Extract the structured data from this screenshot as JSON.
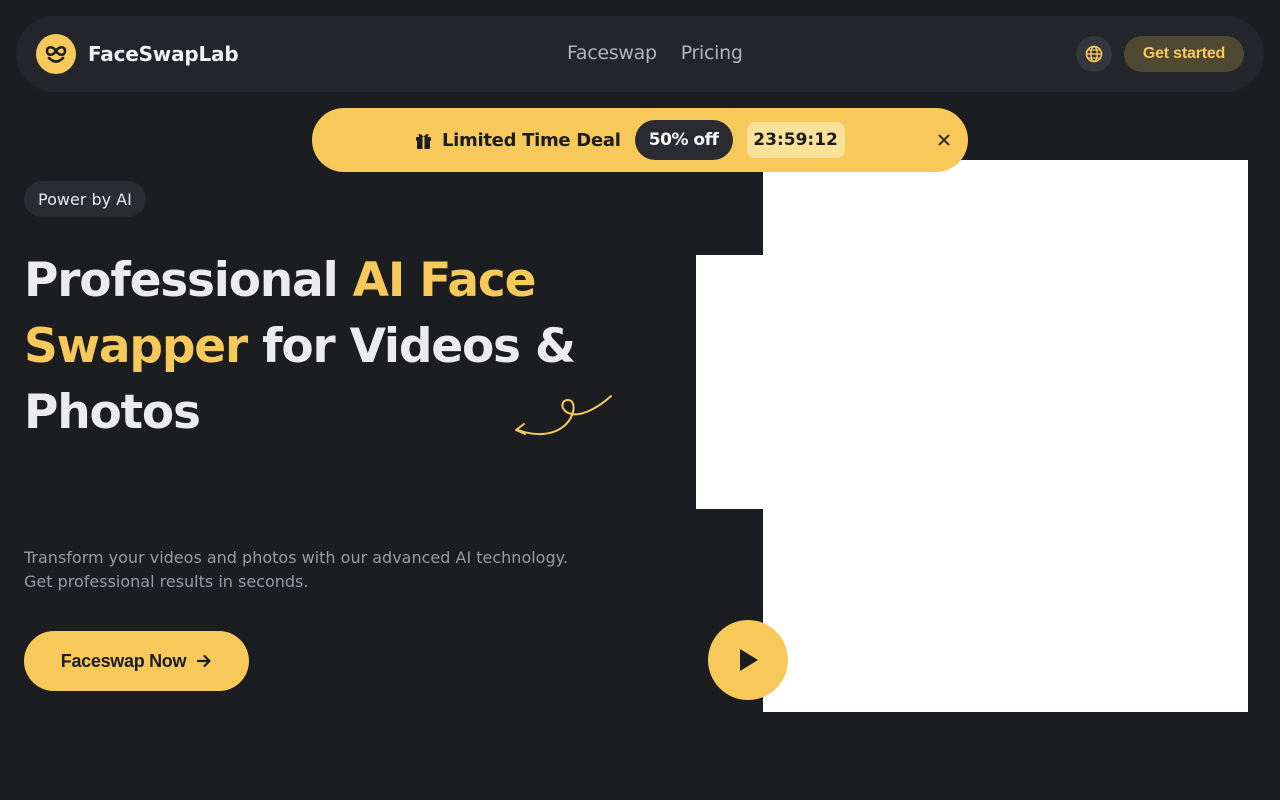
{
  "header": {
    "brand": "FaceSwapLab",
    "logo_icon": "infinity-face-icon",
    "nav": [
      "Faceswap",
      "Pricing"
    ],
    "language_icon": "globe-icon",
    "cta_label": "Get started"
  },
  "deal_banner": {
    "icon": "gift-icon",
    "title": "Limited Time Deal",
    "discount": "50% off",
    "timer": "23:59:12",
    "close_icon": "close-icon"
  },
  "hero": {
    "badge": "Power by AI",
    "title_part1": "Professional ",
    "title_accent": "AI Face Swapper",
    "title_part2": " for Videos & Photos",
    "description_line1": "Transform your videos and photos with our advanced AI technology.",
    "description_line2": "Get professional results in seconds.",
    "cta_label": "Faceswap Now",
    "cta_icon": "arrow-right-icon"
  },
  "media": {
    "play_icon": "play-icon"
  },
  "colors": {
    "background": "#1c1d21",
    "accent": "#f7c95a",
    "header_bg": "#24252a",
    "muted_text": "#9a9ba3"
  }
}
